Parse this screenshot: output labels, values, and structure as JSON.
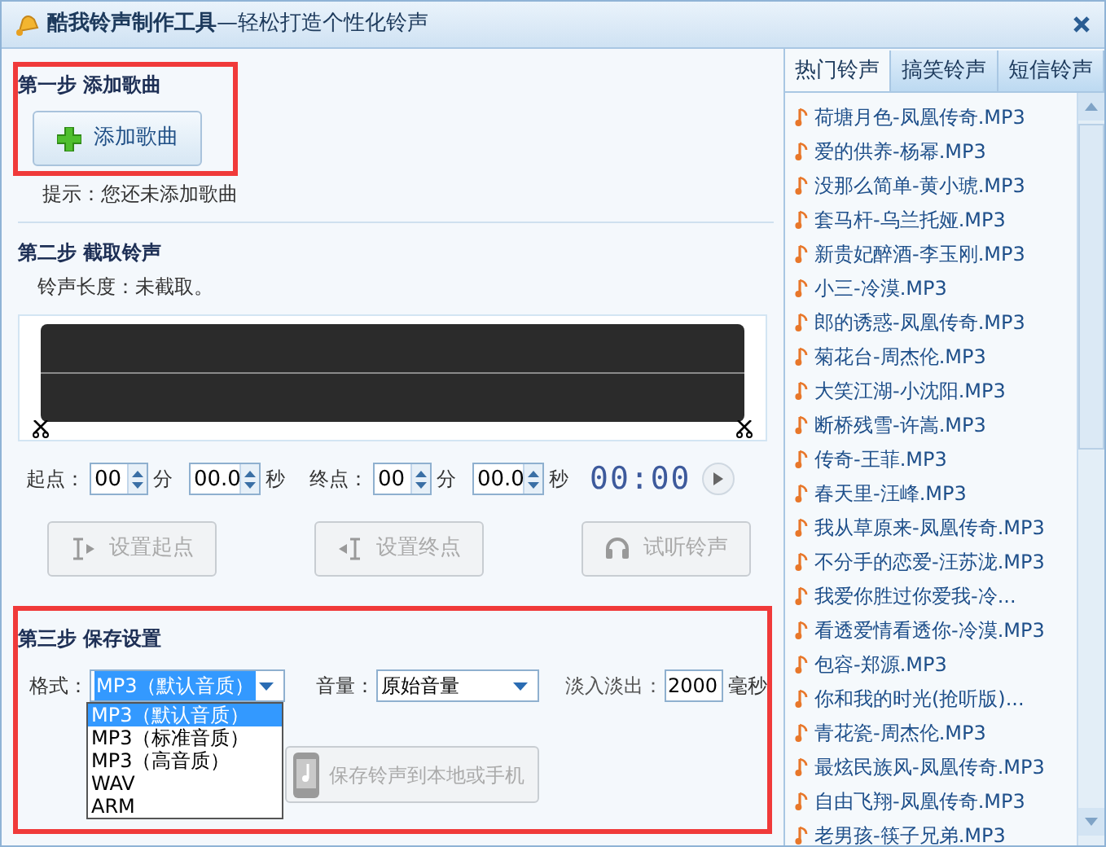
{
  "window": {
    "title": "**酷我铃声制作工具**—轻松打造个性化铃声"
  },
  "step1": {
    "heading": "第一步 添加歌曲",
    "highlighted": true,
    "button": "添加歌曲",
    "hint": "提示：您还未添加歌曲"
  },
  "step2": {
    "heading": "第二步 截取铃声",
    "highlighted": false,
    "length": "铃声长度：未截取。",
    "start": {
      "label": "起点：",
      "min": "00",
      "min_unit": "分",
      "sec": "00.0",
      "sec_unit": "秒"
    },
    "end": {
      "label": "终点：",
      "min": "00",
      "min_unit": "分",
      "sec": "00.0",
      "sec_unit": "秒"
    },
    "clock": "00:00",
    "buttons": [
      {
        "kind": "start",
        "label": "设置起点",
        "disabled": true
      },
      {
        "kind": "end",
        "label": "设置终点",
        "disabled": true
      },
      {
        "kind": "listen",
        "label": "试听铃声",
        "disabled": true
      }
    ]
  },
  "step3": {
    "heading": "第三步 保存设置",
    "highlighted": true,
    "format_label": "格式：",
    "format_value": "MP3（默认音质）",
    "format_options": [
      {
        "label": "MP3（默认音质）",
        "selected": true
      },
      {
        "label": "MP3（标准音质）",
        "selected": false
      },
      {
        "label": "MP3（高音质）",
        "selected": false
      },
      {
        "label": "WAV",
        "selected": false
      },
      {
        "label": "ARM",
        "selected": false
      }
    ],
    "volume_label": "音量：",
    "volume_value": "原始音量",
    "fade_label": "淡入淡出：",
    "fade_value": "2000",
    "fade_unit": "毫秒",
    "save_button": {
      "label": "保存铃声到本地或手机",
      "disabled": true
    }
  },
  "tabs": [
    {
      "label": "热门铃声",
      "selected": true
    },
    {
      "label": "搞笑铃声",
      "selected": false
    },
    {
      "label": "短信铃声",
      "selected": false
    }
  ],
  "songs": [
    "荷塘月色-凤凰传奇.MP3",
    "爱的供养-杨幂.MP3",
    "没那么简单-黄小琥.MP3",
    "套马杆-乌兰托娅.MP3",
    "新贵妃醉酒-李玉刚.MP3",
    "小三-冷漠.MP3",
    "郎的诱惑-凤凰传奇.MP3",
    "菊花台-周杰伦.MP3",
    "大笑江湖-小沈阳.MP3",
    "断桥残雪-许嵩.MP3",
    "传奇-王菲.MP3",
    "春天里-汪峰.MP3",
    "我从草原来-凤凰传奇.MP3",
    "不分手的恋爱-汪苏泷.MP3",
    "我爱你胜过你爱我-冷...",
    "看透爱情看透你-冷漠.MP3",
    "包容-郑源.MP3",
    "你和我的时光(抢听版)...",
    "青花瓷-周杰伦.MP3",
    "最炫民族风-凤凰传奇.MP3",
    "自由飞翔-凤凰传奇.MP3",
    "老男孩-筷子兄弟.MP3"
  ]
}
